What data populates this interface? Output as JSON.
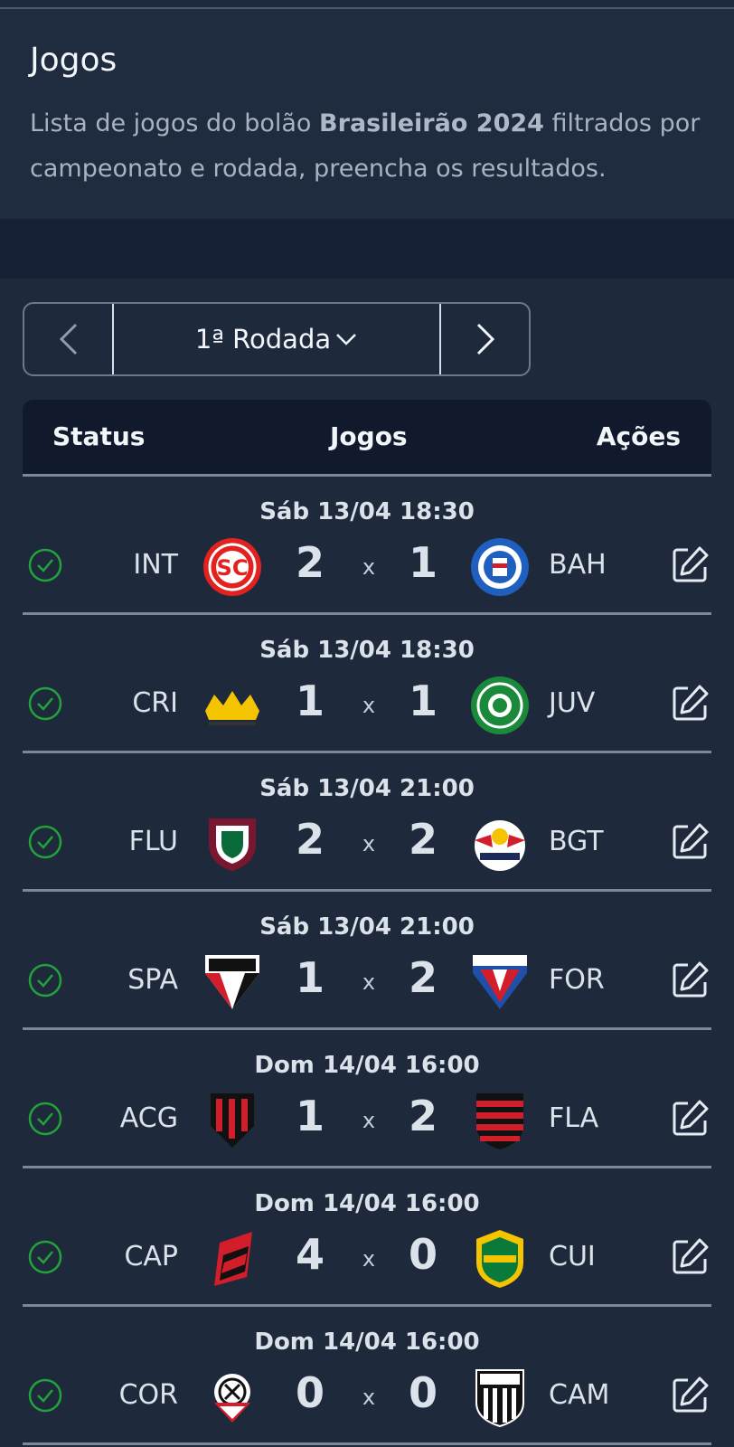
{
  "header": {
    "title": "Jogos",
    "desc_before": "Lista de jogos do bolão ",
    "desc_bold": "Brasileirão 2024",
    "desc_after": " filtrados por campeonato e rodada, preencha os resultados."
  },
  "round_nav": {
    "current": "1ª Rodada",
    "prev_icon": "chevron-left-icon",
    "next_icon": "chevron-right-icon",
    "dropdown_icon": "chevron-down-icon"
  },
  "table": {
    "headers": {
      "status": "Status",
      "games": "Jogos",
      "actions": "Ações"
    },
    "x_label": "x",
    "status_color": "#22a33a",
    "matches": [
      {
        "when": "Sáb 13/04 18:30",
        "home": "INT",
        "home_score": "2",
        "away_score": "1",
        "away": "BAH"
      },
      {
        "when": "Sáb 13/04 18:30",
        "home": "CRI",
        "home_score": "1",
        "away_score": "1",
        "away": "JUV"
      },
      {
        "when": "Sáb 13/04 21:00",
        "home": "FLU",
        "home_score": "2",
        "away_score": "2",
        "away": "BGT"
      },
      {
        "when": "Sáb 13/04 21:00",
        "home": "SPA",
        "home_score": "1",
        "away_score": "2",
        "away": "FOR"
      },
      {
        "when": "Dom 14/04 16:00",
        "home": "ACG",
        "home_score": "1",
        "away_score": "2",
        "away": "FLA"
      },
      {
        "when": "Dom 14/04 16:00",
        "home": "CAP",
        "home_score": "4",
        "away_score": "0",
        "away": "CUI"
      },
      {
        "when": "Dom 14/04 16:00",
        "home": "COR",
        "home_score": "0",
        "away_score": "0",
        "away": "CAM"
      }
    ]
  }
}
